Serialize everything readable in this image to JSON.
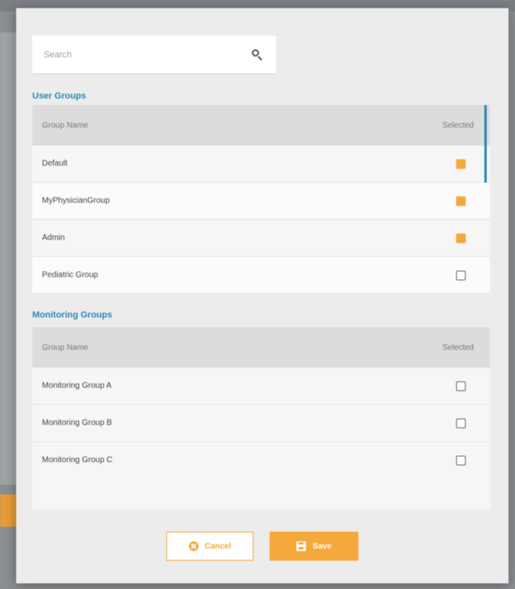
{
  "search": {
    "placeholder": "Search"
  },
  "user_groups": {
    "title": "User Groups",
    "columns": [
      "Group Name",
      "Selected"
    ],
    "rows": [
      {
        "name": "Default",
        "selected": true
      },
      {
        "name": "MyPhysicianGroup",
        "selected": true
      },
      {
        "name": "Admin",
        "selected": true
      },
      {
        "name": "Pediatric Group",
        "selected": false
      }
    ]
  },
  "monitoring_groups": {
    "title": "Monitoring Groups",
    "columns": [
      "Group Name",
      "Selected"
    ],
    "rows": [
      {
        "name": "Monitoring Group A",
        "selected": false
      },
      {
        "name": "Monitoring Group B",
        "selected": false
      },
      {
        "name": "Monitoring Group C",
        "selected": false
      }
    ]
  },
  "buttons": {
    "cancel_label": "Cancel",
    "save_label": "Save"
  },
  "colors": {
    "accent": "#f5a93a",
    "section_title": "#2a86b8"
  }
}
